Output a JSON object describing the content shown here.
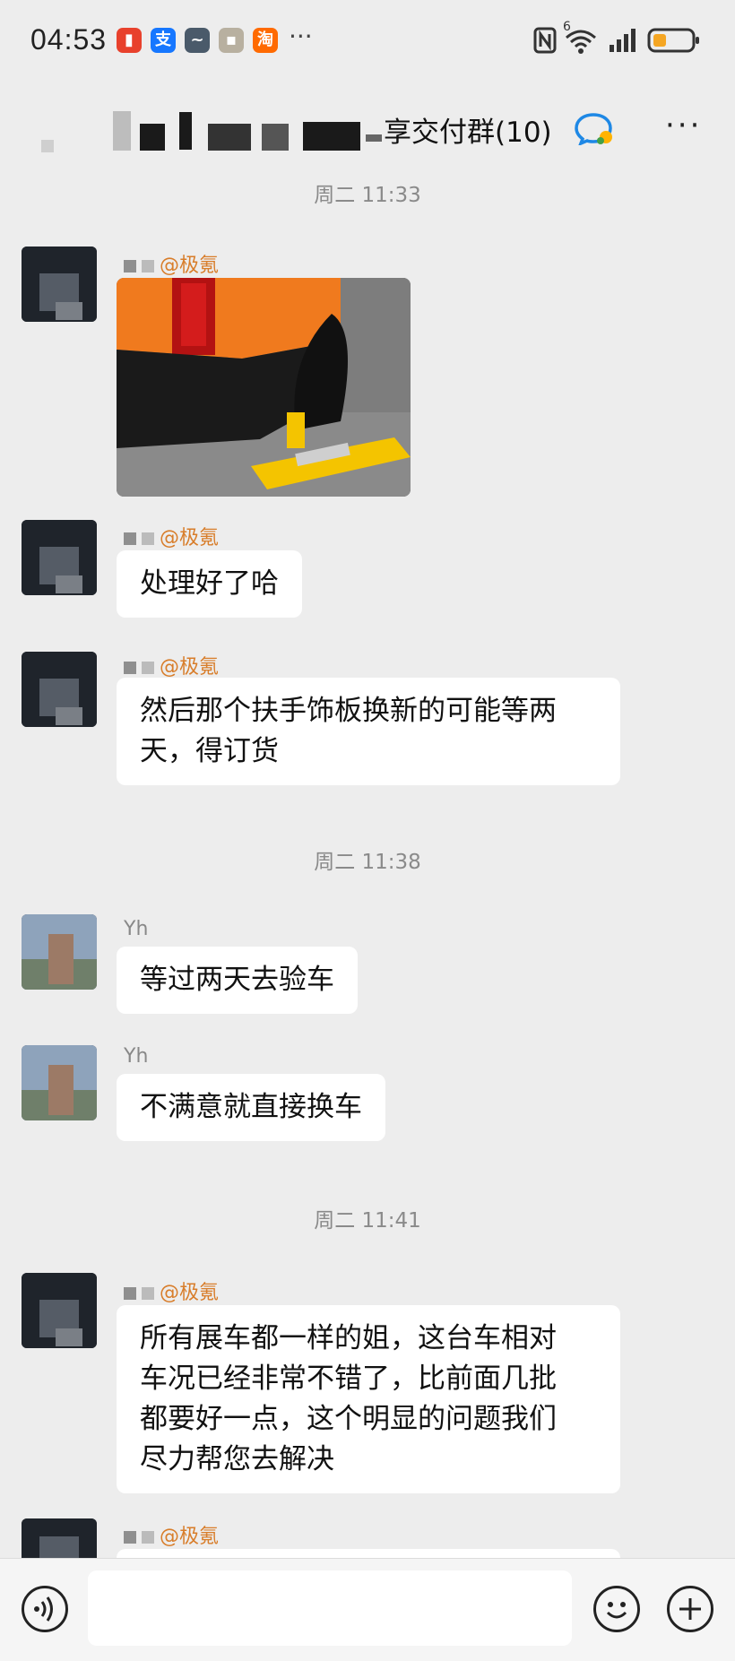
{
  "status": {
    "time": "04:53",
    "more": "···",
    "network": "6"
  },
  "header": {
    "title": "享交付群(10)",
    "more": "···"
  },
  "timestamps": [
    "周二 11:33",
    "周二 11:38",
    "周二 11:41"
  ],
  "messages": [
    {
      "sender_org": "@极氪",
      "type": "image"
    },
    {
      "sender_org": "@极氪",
      "text": "处理好了哈"
    },
    {
      "sender_org": "@极氪",
      "line1": "然后那个扶手饰板换新的可能等两",
      "line2": "天，得订货"
    },
    {
      "sender": "Yh",
      "text": "等过两天去验车"
    },
    {
      "sender": "Yh",
      "text": "不满意就直接换车"
    },
    {
      "sender_org": "@极氪",
      "line1": "所有展车都一样的姐，这台车相对",
      "line2": "车况已经非常不错了，比前面几批",
      "line3": "都要好一点，这个明显的问题我们",
      "line4": "尽力帮您去解决"
    },
    {
      "sender_org": "@极氪"
    }
  ],
  "colors": {
    "background": "#ededed",
    "bubble": "#ffffff",
    "sender_org": "#d87d2a"
  },
  "icons": [
    "voice-icon",
    "emoji-icon",
    "plus-icon",
    "verified-icon"
  ]
}
